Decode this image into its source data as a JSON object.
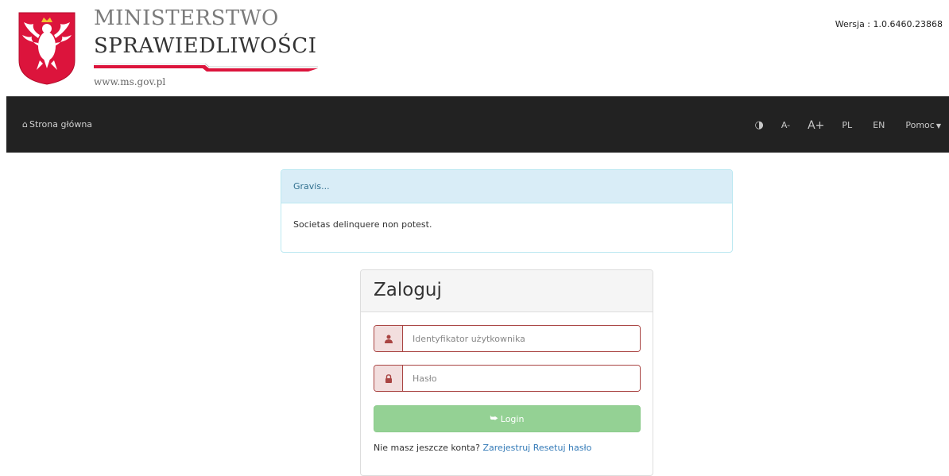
{
  "header": {
    "brand_line1": "MINISTERSTWO",
    "brand_line2": "SPRAWIEDLIWOŚCI",
    "brand_url": "www.ms.gov.pl",
    "version": "Wersja : 1.0.6460.23868",
    "emblem_icon": "polish-eagle-emblem"
  },
  "navbar": {
    "home_label": "Strona główna",
    "home_icon": "home-icon",
    "contrast_icon": "contrast-icon",
    "font_smaller": "A-",
    "font_larger": "A+",
    "lang_pl": "PL",
    "lang_en": "EN",
    "help_label": "Pomoc",
    "background_color": "#222222"
  },
  "alert": {
    "title": "Gravis...",
    "message": "Societas delinquere non potest.",
    "accent_color": "#d9edf7"
  },
  "login": {
    "title": "Zaloguj",
    "username_placeholder": "Identyfikator użytkownika",
    "username_value": "",
    "password_placeholder": "Hasło",
    "password_value": "",
    "login_button": "Login",
    "no_account_text": "Nie masz jeszcze konta?",
    "register_link": "Zarejestruj",
    "reset_link": "Resetuj hasło",
    "error_color": "#a94442",
    "button_color": "#94d194"
  }
}
